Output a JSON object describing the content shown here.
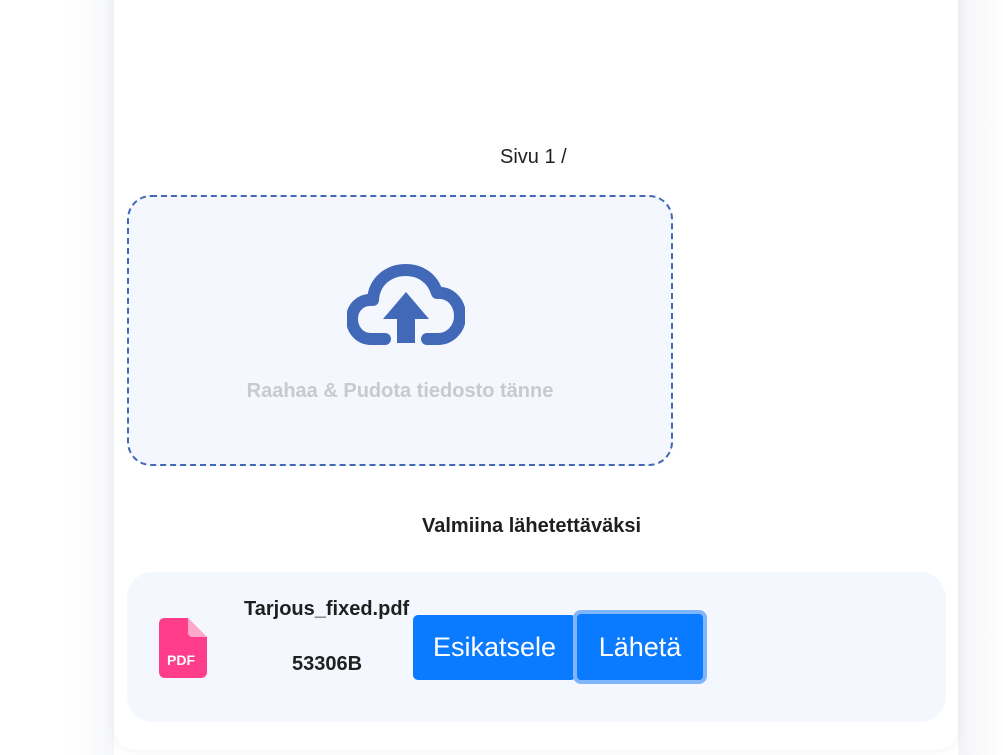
{
  "pagination": {
    "label": "Sivu 1 /"
  },
  "dropzone": {
    "icon": "cloud-upload-icon",
    "text": "Raahaa & Pudota tiedosto tänne",
    "border_color": "#4169b8",
    "background": "#f4f7fd"
  },
  "ready_section": {
    "heading": "Valmiina lähetettäväksi",
    "file": {
      "icon": "pdf-file-icon",
      "icon_label": "PDF",
      "icon_color": "#ff3d8b",
      "name": "Tarjous_fixed.pdf",
      "size": "53306B"
    },
    "actions": {
      "preview_label": "Esikatsele",
      "send_label": "Lähetä",
      "button_color": "#0a7aff"
    }
  }
}
